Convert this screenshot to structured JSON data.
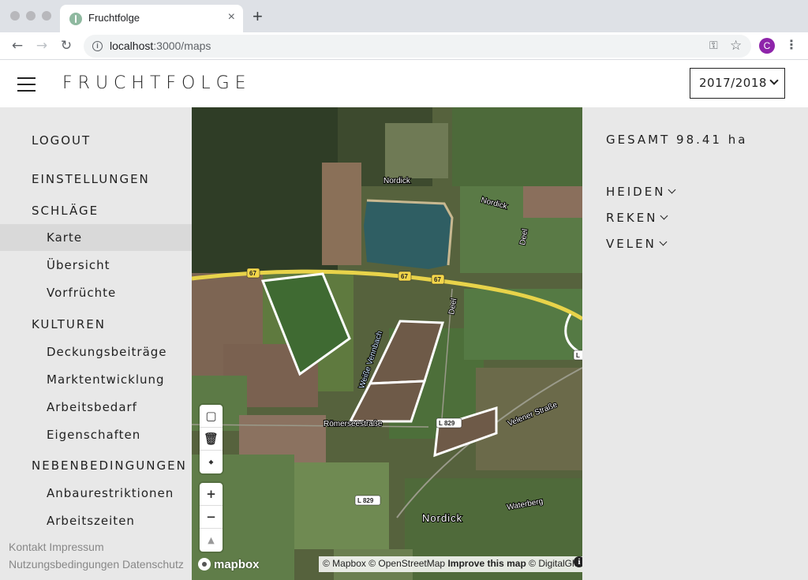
{
  "browser": {
    "tab_title": "Fruchtfolge",
    "tab_close": "×",
    "new_tab": "+",
    "url_host": "localhost",
    "url_path": ":3000/maps",
    "profile_initial": "C"
  },
  "header": {
    "brand": "FRUCHTFOLGE",
    "year_selected": "2017/2018"
  },
  "sidebar": {
    "items": [
      {
        "label": "LOGOUT",
        "level": "top"
      },
      {
        "label": "EINSTELLUNGEN",
        "level": "top"
      },
      {
        "label": "SCHLÄGE",
        "level": "top"
      },
      {
        "label": "Karte",
        "level": "sub",
        "active": true
      },
      {
        "label": "Übersicht",
        "level": "sub"
      },
      {
        "label": "Vorfrüchte",
        "level": "sub"
      },
      {
        "label": "KULTUREN",
        "level": "top"
      },
      {
        "label": "Deckungsbeiträge",
        "level": "sub"
      },
      {
        "label": "Marktentwicklung",
        "level": "sub"
      },
      {
        "label": "Arbeitsbedarf",
        "level": "sub"
      },
      {
        "label": "Eigenschaften",
        "level": "sub"
      },
      {
        "label": "NEBENBEDINGUNGEN",
        "level": "top"
      },
      {
        "label": "Anbaurestriktionen",
        "level": "sub"
      },
      {
        "label": "Arbeitszeiten",
        "level": "sub"
      }
    ],
    "footer": {
      "kontakt": "Kontakt",
      "impressum": "Impressum",
      "nutzungsbedingungen": "Nutzungsbedingungen",
      "datenschutz": "Datenschutz"
    }
  },
  "map": {
    "labels": {
      "nordick_top": "Nordick",
      "nordick_right": "Nordick",
      "deel_right": "Deel",
      "deel_center": "Deel",
      "road_67": "67",
      "weisse_vennbach": "Weiße Vennbach",
      "roemerseestrasse": "Römerseestraße",
      "l829_a": "L 829",
      "l829_b": "L 829",
      "velener_strasse": "Velener Straße",
      "waterberg": "Waterberg",
      "nordick_town": "Nordick",
      "l_edge": "L"
    },
    "controls": {
      "draw_polygon": "▢",
      "trash": "🗑",
      "combine": "⬩",
      "zoom_in": "+",
      "zoom_out": "−",
      "compass": "▲"
    },
    "logo": "mapbox",
    "attribution": {
      "mapbox": "© Mapbox",
      "osm": "© OpenStreetMap",
      "improve": "Improve this map",
      "digitalglobe": "© DigitalGlo"
    }
  },
  "summary": {
    "total": "GESAMT 98.41 ha",
    "regions": [
      "HEIDEN",
      "REKEN",
      "VELEN"
    ]
  }
}
